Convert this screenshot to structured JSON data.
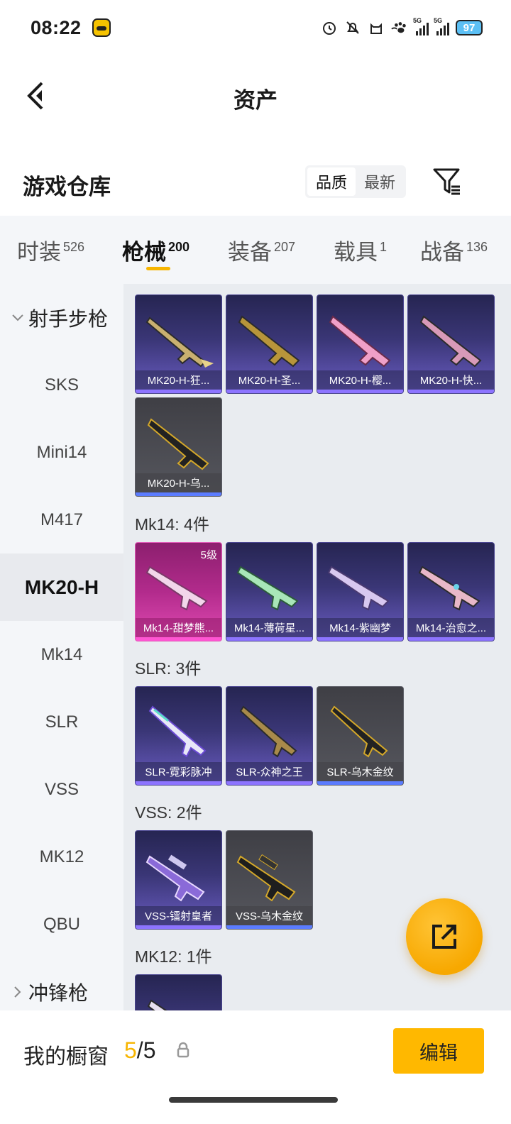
{
  "status_bar": {
    "time": "08:22",
    "signal_1": "5G",
    "signal_2": "5G",
    "battery": "97"
  },
  "header": {
    "title": "资产"
  },
  "warehouse": {
    "title": "游戏仓库",
    "sort_options": [
      "品质",
      "最新"
    ],
    "active_sort": "品质"
  },
  "tabs": [
    {
      "label": "时装",
      "count": "526"
    },
    {
      "label": "枪械",
      "count": "200"
    },
    {
      "label": "装备",
      "count": "207"
    },
    {
      "label": "载具",
      "count": "1"
    },
    {
      "label": "战备",
      "count": "136"
    }
  ],
  "active_tab": "枪械",
  "sidebar": {
    "group_expanded": "射手步枪",
    "items": [
      "SKS",
      "Mini14",
      "M417",
      "MK20-H",
      "Mk14",
      "SLR",
      "VSS",
      "MK12",
      "QBU"
    ],
    "active_item": "MK20-H",
    "group_collapsed": "冲锋枪"
  },
  "sections": {
    "mk20h": {
      "cards": [
        "MK20-H-狂...",
        "MK20-H-圣...",
        "MK20-H-樱...",
        "MK20-H-快...",
        "MK20-H-乌..."
      ]
    },
    "mk14": {
      "title": "Mk14: 4件",
      "cards": [
        "Mk14-甜梦熊...",
        "Mk14-薄荷星...",
        "Mk14-紫幽梦",
        "Mk14-治愈之..."
      ],
      "first_level": "5级"
    },
    "slr": {
      "title": "SLR: 3件",
      "cards": [
        "SLR-霓彩脉冲",
        "SLR-众神之王",
        "SLR-乌木金纹"
      ]
    },
    "vss": {
      "title": "VSS: 2件",
      "cards": [
        "VSS-镭射皇者",
        "VSS-乌木金纹"
      ]
    },
    "mk12": {
      "title": "MK12: 1件"
    }
  },
  "bottom": {
    "showcase_label": "我的橱窗",
    "current": "5",
    "separator": "/",
    "total": "5",
    "edit_label": "编辑"
  },
  "colors": {
    "accent": "#f7b500",
    "purple_rarity": "#8d74ff",
    "pink_rarity": "#ff55d2",
    "gray_rarity": "#5b7cff"
  },
  "icons": [
    "back-arrow-icon",
    "filter-icon",
    "chevron-down-icon",
    "chevron-right-icon",
    "share-external-icon",
    "lock-icon"
  ]
}
